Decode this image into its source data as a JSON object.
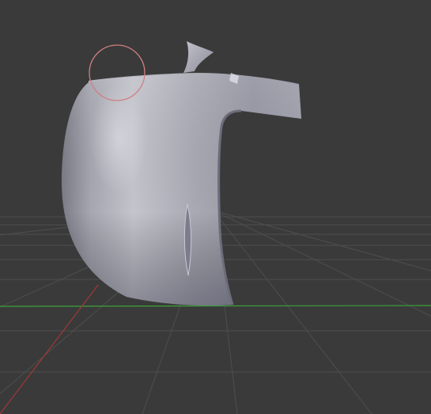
{
  "viewport": {
    "background": "#3a3a3a",
    "grid_visible": true,
    "grid_color": "#4e4e4e",
    "x_axis_color": "#3aa33a",
    "y_axis_color": "#a23838"
  },
  "brush": {
    "cursor_color": "#d08080"
  },
  "mesh": {
    "material_color": "#a8a8b2",
    "highlight_color": "#e4e4ec",
    "shadow_color": "#6a6a78"
  }
}
